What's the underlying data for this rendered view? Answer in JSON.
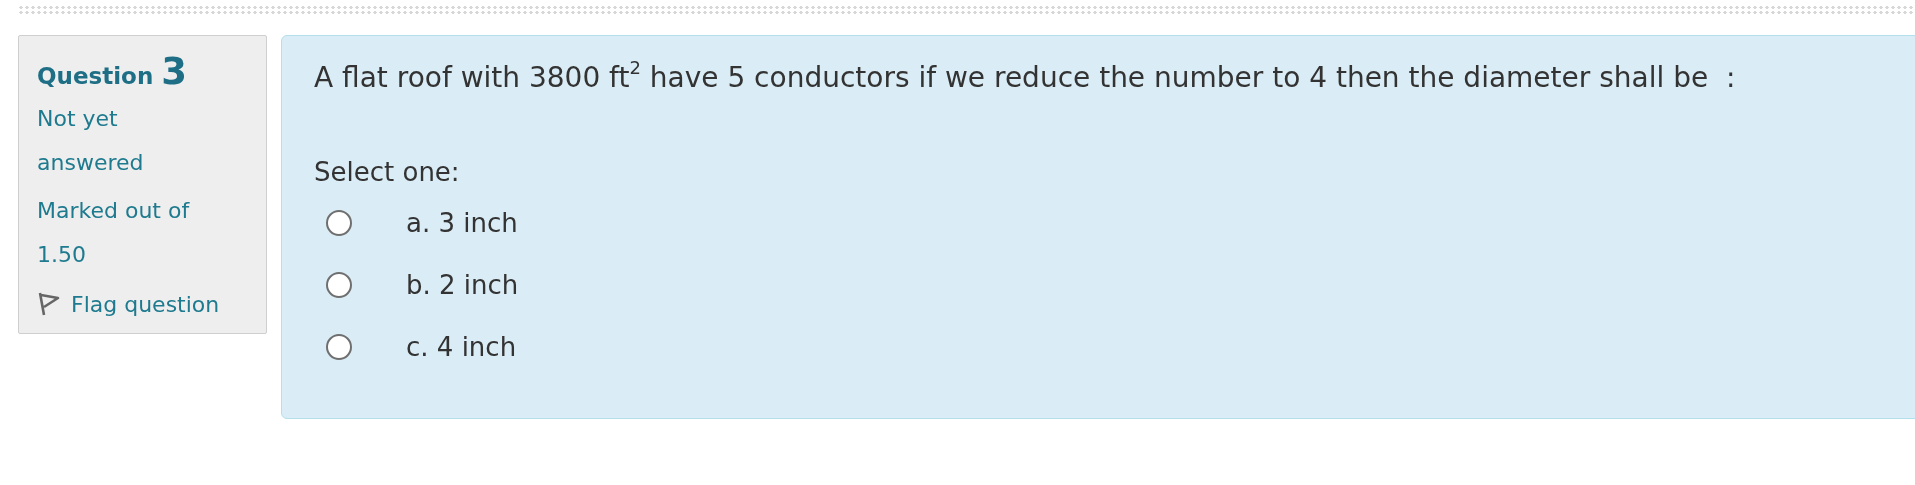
{
  "question": {
    "label": "Question",
    "number": "3",
    "status": "Not yet answered",
    "marks": "Marked out of 1.50",
    "flag": {
      "label": "Flag question",
      "flagged": false
    }
  },
  "content": {
    "text": "A flat roof with 3800 ft$^{2}$ have 5 conductors if we reduce the number to 4 then the diameter shall be  :",
    "prompt": "Select one:",
    "options": [
      {
        "label": "a. 3 inch",
        "selected": false
      },
      {
        "label": "b. 2 inch",
        "selected": false
      },
      {
        "label": "c. 4 inch",
        "selected": false
      }
    ]
  }
}
